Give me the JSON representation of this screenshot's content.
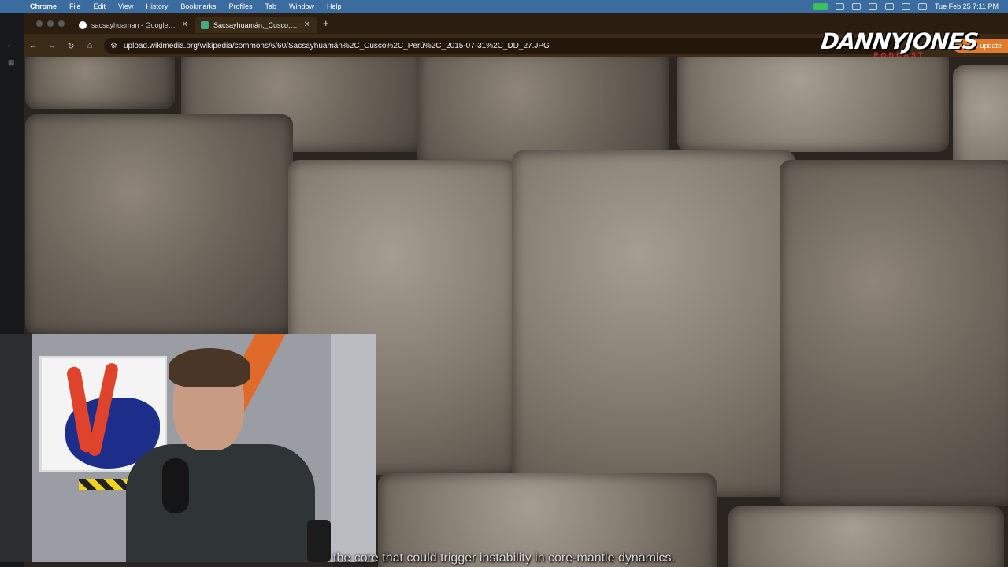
{
  "menubar": {
    "app_name": "Chrome",
    "items": [
      "File",
      "Edit",
      "View",
      "History",
      "Bookmarks",
      "Profiles",
      "Tab",
      "Window",
      "Help"
    ],
    "clock": "Tue Feb 25  7:11 PM"
  },
  "tabs": [
    {
      "title": "sacsayhuaman - Google Sea",
      "favicon": "google-icon",
      "active": false
    },
    {
      "title": "Sacsayhuamán,_Cusco,_Perú",
      "favicon": "wikimedia-icon",
      "active": true
    }
  ],
  "address_bar": {
    "url": "upload.wikimedia.org/wikipedia/commons/6/60/Sacsayhuamán%2C_Cusco%2C_Perú%2C_2015-07-31%2C_DD_27.JPG"
  },
  "update_button": {
    "label": "sh update"
  },
  "logo": {
    "line1": "DANNYJONES",
    "line2": "PODCAST"
  },
  "caption": {
    "text": "the core that could trigger instability in core-mantle dynamics."
  }
}
